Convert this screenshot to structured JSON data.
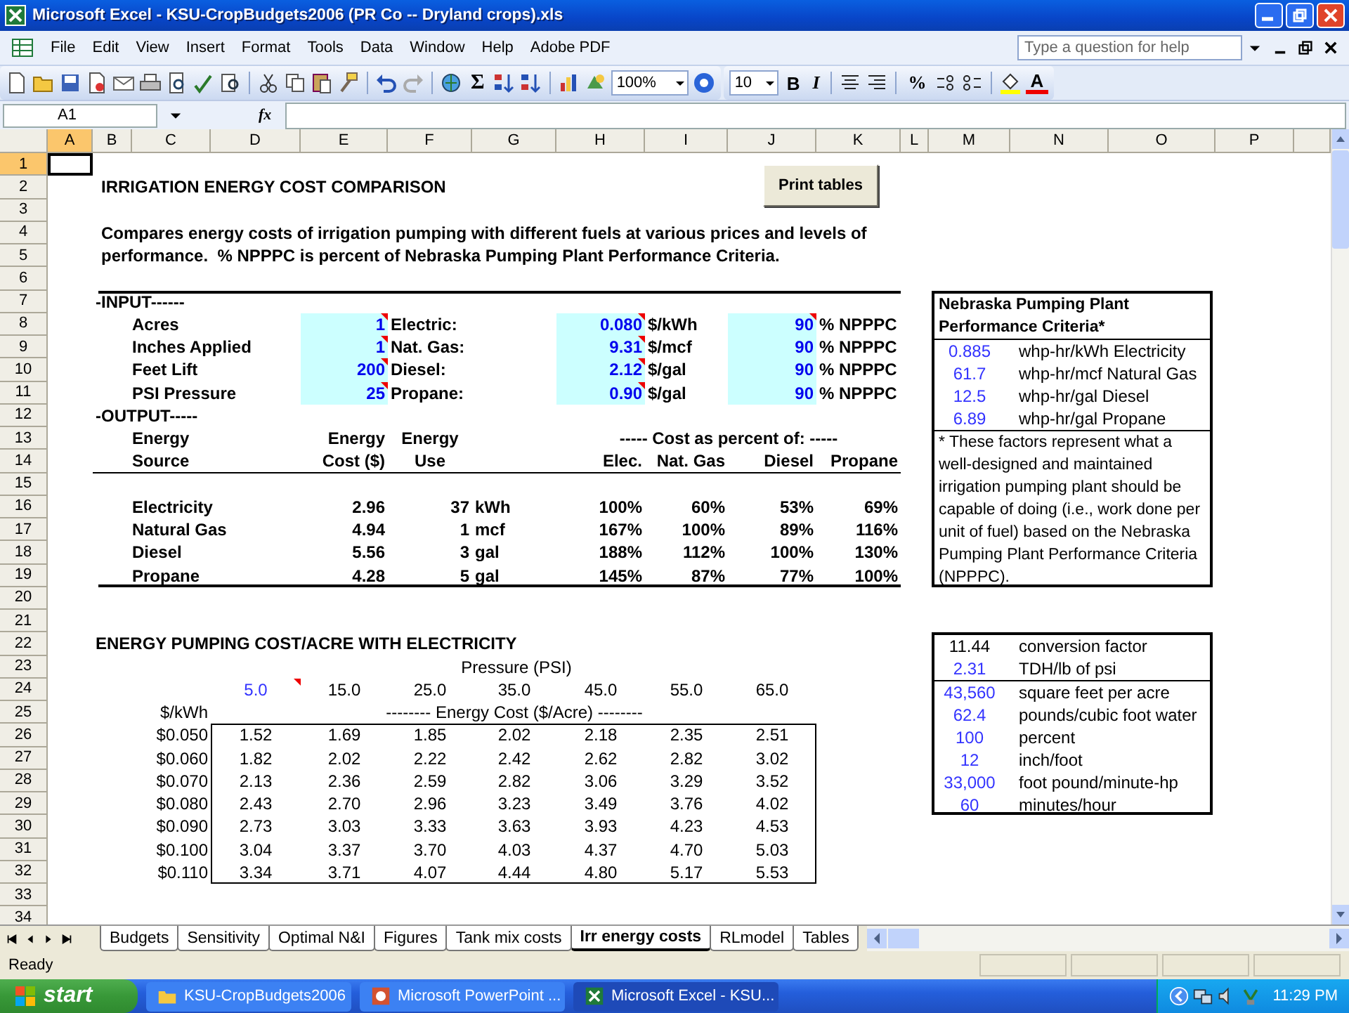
{
  "window": {
    "title": "Microsoft Excel - KSU-CropBudgets2006 (PR Co -- Dryland crops).xls"
  },
  "menu": [
    "File",
    "Edit",
    "View",
    "Insert",
    "Format",
    "Tools",
    "Data",
    "Window",
    "Help",
    "Adobe PDF"
  ],
  "help_box": {
    "placeholder": "Type a question for help"
  },
  "toolbar": {
    "sum": "Σ",
    "zoom": "100%",
    "font_size": "10",
    "bold": "B",
    "italic": "I",
    "percent": "%",
    "font_color": "A"
  },
  "formula_bar": {
    "name_box": "A1",
    "function_label": "fx"
  },
  "columns": [
    {
      "label": "A",
      "selected": true
    },
    {
      "label": "B",
      "selected": false
    },
    {
      "label": "C",
      "selected": false
    },
    {
      "label": "D",
      "selected": false
    },
    {
      "label": "E",
      "selected": false
    },
    {
      "label": "F",
      "selected": false
    },
    {
      "label": "G",
      "selected": false
    },
    {
      "label": "H",
      "selected": false
    },
    {
      "label": "I",
      "selected": false
    },
    {
      "label": "J",
      "selected": false
    },
    {
      "label": "K",
      "selected": false
    },
    {
      "label": "L",
      "selected": false
    },
    {
      "label": "M",
      "selected": false
    },
    {
      "label": "N",
      "selected": false
    },
    {
      "label": "O",
      "selected": false
    },
    {
      "label": "P",
      "selected": false
    }
  ],
  "rows": [
    {
      "label": "1",
      "selected": true
    },
    {
      "label": "2",
      "selected": false
    },
    {
      "label": "3",
      "selected": false
    },
    {
      "label": "4",
      "selected": false
    },
    {
      "label": "5",
      "selected": false
    },
    {
      "label": "6",
      "selected": false
    },
    {
      "label": "7",
      "selected": false
    },
    {
      "label": "8",
      "selected": false
    },
    {
      "label": "9",
      "selected": false
    },
    {
      "label": "10",
      "selected": false
    },
    {
      "label": "11",
      "selected": false
    },
    {
      "label": "12",
      "selected": false
    },
    {
      "label": "13",
      "selected": false
    },
    {
      "label": "14",
      "selected": false
    },
    {
      "label": "15",
      "selected": false
    },
    {
      "label": "16",
      "selected": false
    },
    {
      "label": "17",
      "selected": false
    },
    {
      "label": "18",
      "selected": false
    },
    {
      "label": "19",
      "selected": false
    },
    {
      "label": "20",
      "selected": false
    },
    {
      "label": "21",
      "selected": false
    },
    {
      "label": "22",
      "selected": false
    },
    {
      "label": "23",
      "selected": false
    },
    {
      "label": "24",
      "selected": false
    },
    {
      "label": "25",
      "selected": false
    },
    {
      "label": "26",
      "selected": false
    },
    {
      "label": "27",
      "selected": false
    },
    {
      "label": "28",
      "selected": false
    },
    {
      "label": "29",
      "selected": false
    },
    {
      "label": "30",
      "selected": false
    },
    {
      "label": "31",
      "selected": false
    },
    {
      "label": "32",
      "selected": false
    },
    {
      "label": "33",
      "selected": false
    },
    {
      "label": "34",
      "selected": false
    }
  ],
  "sheet": {
    "title": "IRRIGATION ENERGY COST COMPARISON",
    "print_button": "Print tables",
    "description": "Compares energy costs of irrigation pumping with different fuels at various prices and levels of performance.  % NPPPC is percent of Nebraska Pumping Plant Performance Criteria.",
    "input_heading": "-INPUT------",
    "inputs": [
      {
        "label": "Acres",
        "value": "1",
        "commented": true
      },
      {
        "label": "Inches Applied",
        "value": "1",
        "commented": true
      },
      {
        "label": "Feet Lift",
        "value": "200",
        "commented": true
      },
      {
        "label": "PSI Pressure",
        "value": "25",
        "commented": true
      }
    ],
    "fuels": [
      {
        "label": "Electric:",
        "price": "0.080",
        "price_commented": true,
        "unit": "$/kWh",
        "efficiency": "90",
        "efficiency_commented": true,
        "efficiency_unit": "% NPPPC"
      },
      {
        "label": "Nat. Gas:",
        "price": "9.31",
        "price_commented": true,
        "unit": "$/mcf",
        "efficiency": "90",
        "efficiency_commented": false,
        "efficiency_unit": "% NPPPC"
      },
      {
        "label": "Diesel:",
        "price": "2.12",
        "price_commented": true,
        "unit": "$/gal",
        "efficiency": "90",
        "efficiency_commented": false,
        "efficiency_unit": "% NPPPC"
      },
      {
        "label": "Propane:",
        "price": "0.90",
        "price_commented": true,
        "unit": "$/gal",
        "efficiency": "90",
        "efficiency_commented": false,
        "efficiency_unit": "% NPPPC"
      }
    ],
    "output_heading": "-OUTPUT-----",
    "output_header": {
      "source": [
        "Energy",
        "Source"
      ],
      "cost": [
        "Energy",
        "Cost ($)"
      ],
      "use": [
        "Energy",
        "Use"
      ],
      "comparison": "----- Cost as percent of: -----",
      "percent_of": [
        "Elec.",
        "Nat. Gas",
        "Diesel",
        "Propane"
      ]
    },
    "outputs": [
      {
        "source": "Electricity",
        "cost": "2.96",
        "use": "37",
        "use_unit": "kWh",
        "percents": [
          "100%",
          "60%",
          "53%",
          "69%"
        ]
      },
      {
        "source": "Natural Gas",
        "cost": "4.94",
        "use": "1",
        "use_unit": "mcf",
        "percents": [
          "167%",
          "100%",
          "89%",
          "116%"
        ]
      },
      {
        "source": "Diesel",
        "cost": "5.56",
        "use": "3",
        "use_unit": "gal",
        "percents": [
          "188%",
          "112%",
          "100%",
          "130%"
        ]
      },
      {
        "source": "Propane",
        "cost": "4.28",
        "use": "5",
        "use_unit": "gal",
        "percents": [
          "145%",
          "87%",
          "77%",
          "100%"
        ]
      }
    ],
    "criteria": {
      "title": "Nebraska Pumping Plant Performance Criteria*",
      "factors": [
        {
          "value": "0.885",
          "unit": "whp-hr/kWh Electricity"
        },
        {
          "value": "61.7",
          "unit": "whp-hr/mcf Natural Gas"
        },
        {
          "value": "12.5",
          "unit": "whp-hr/gal Diesel"
        },
        {
          "value": "6.89",
          "unit": "whp-hr/gal Propane"
        }
      ],
      "note": "* These factors represent what a well-designed and maintained irrigation pumping plant should be capable of doing (i.e., work done per unit of fuel) based on the Nebraska Pumping Plant Performance Criteria (NPPPC)."
    },
    "pumping": {
      "title": "ENERGY PUMPING COST/ACRE WITH ELECTRICITY",
      "pressure_label": "Pressure (PSI)",
      "pressures": [
        {
          "value": "5.0",
          "kind": "input",
          "commented": true
        },
        {
          "value": "15.0",
          "kind": "formula",
          "commented": false
        },
        {
          "value": "25.0",
          "kind": "formula",
          "commented": false
        },
        {
          "value": "35.0",
          "kind": "formula",
          "commented": false
        },
        {
          "value": "45.0",
          "kind": "formula",
          "commented": false
        },
        {
          "value": "55.0",
          "kind": "formula",
          "commented": false
        },
        {
          "value": "65.0",
          "kind": "formula",
          "commented": false
        }
      ],
      "price_label": "$/kWh",
      "cost_label": "-------- Energy Cost ($/Acre) --------",
      "rows": [
        {
          "price": "$0.050",
          "costs": [
            "1.52",
            "1.69",
            "1.85",
            "2.02",
            "2.18",
            "2.35",
            "2.51"
          ]
        },
        {
          "price": "$0.060",
          "costs": [
            "1.82",
            "2.02",
            "2.22",
            "2.42",
            "2.62",
            "2.82",
            "3.02"
          ]
        },
        {
          "price": "$0.070",
          "costs": [
            "2.13",
            "2.36",
            "2.59",
            "2.82",
            "3.06",
            "3.29",
            "3.52"
          ]
        },
        {
          "price": "$0.080",
          "costs": [
            "2.43",
            "2.70",
            "2.96",
            "3.23",
            "3.49",
            "3.76",
            "4.02"
          ]
        },
        {
          "price": "$0.090",
          "costs": [
            "2.73",
            "3.03",
            "3.33",
            "3.63",
            "3.93",
            "4.23",
            "4.53"
          ]
        },
        {
          "price": "$0.100",
          "costs": [
            "3.04",
            "3.37",
            "3.70",
            "4.03",
            "4.37",
            "4.70",
            "5.03"
          ]
        },
        {
          "price": "$0.110",
          "costs": [
            "3.34",
            "3.71",
            "4.07",
            "4.44",
            "4.80",
            "5.17",
            "5.53"
          ]
        }
      ]
    },
    "constant_groups": [
      {
        "items": [
          {
            "value": "11.44",
            "label": "conversion factor",
            "kind": "formula"
          },
          {
            "value": "2.31",
            "label": "TDH/lb of psi",
            "kind": "input"
          }
        ]
      },
      {
        "items": [
          {
            "value": "43,560",
            "label": "square feet per acre",
            "kind": "input"
          },
          {
            "value": "62.4",
            "label": "pounds/cubic foot water",
            "kind": "input"
          },
          {
            "value": "100",
            "label": "percent",
            "kind": "input"
          },
          {
            "value": "12",
            "label": "inch/foot",
            "kind": "input"
          },
          {
            "value": "33,000",
            "label": "foot pound/minute-hp",
            "kind": "input"
          },
          {
            "value": "60",
            "label": "minutes/hour",
            "kind": "input"
          }
        ]
      }
    ]
  },
  "sheet_tabs": [
    {
      "label": "Budgets",
      "selected": false
    },
    {
      "label": "Sensitivity",
      "selected": false
    },
    {
      "label": "Optimal N&I",
      "selected": false
    },
    {
      "label": "Figures",
      "selected": false
    },
    {
      "label": "Tank mix costs",
      "selected": false
    },
    {
      "label": "Irr energy costs",
      "selected": true
    },
    {
      "label": "RLmodel",
      "selected": false
    },
    {
      "label": "Tables",
      "selected": false
    }
  ],
  "status_bar": {
    "text": "Ready"
  },
  "taskbar": {
    "start": "start",
    "tasks": [
      {
        "label": "KSU-CropBudgets2006",
        "kind": "folder",
        "selected": false
      },
      {
        "label": "Microsoft PowerPoint ...",
        "kind": "powerpoint",
        "selected": false
      },
      {
        "label": "Microsoft Excel - KSU...",
        "kind": "excel",
        "selected": true
      }
    ],
    "clock": "11:29 PM"
  }
}
